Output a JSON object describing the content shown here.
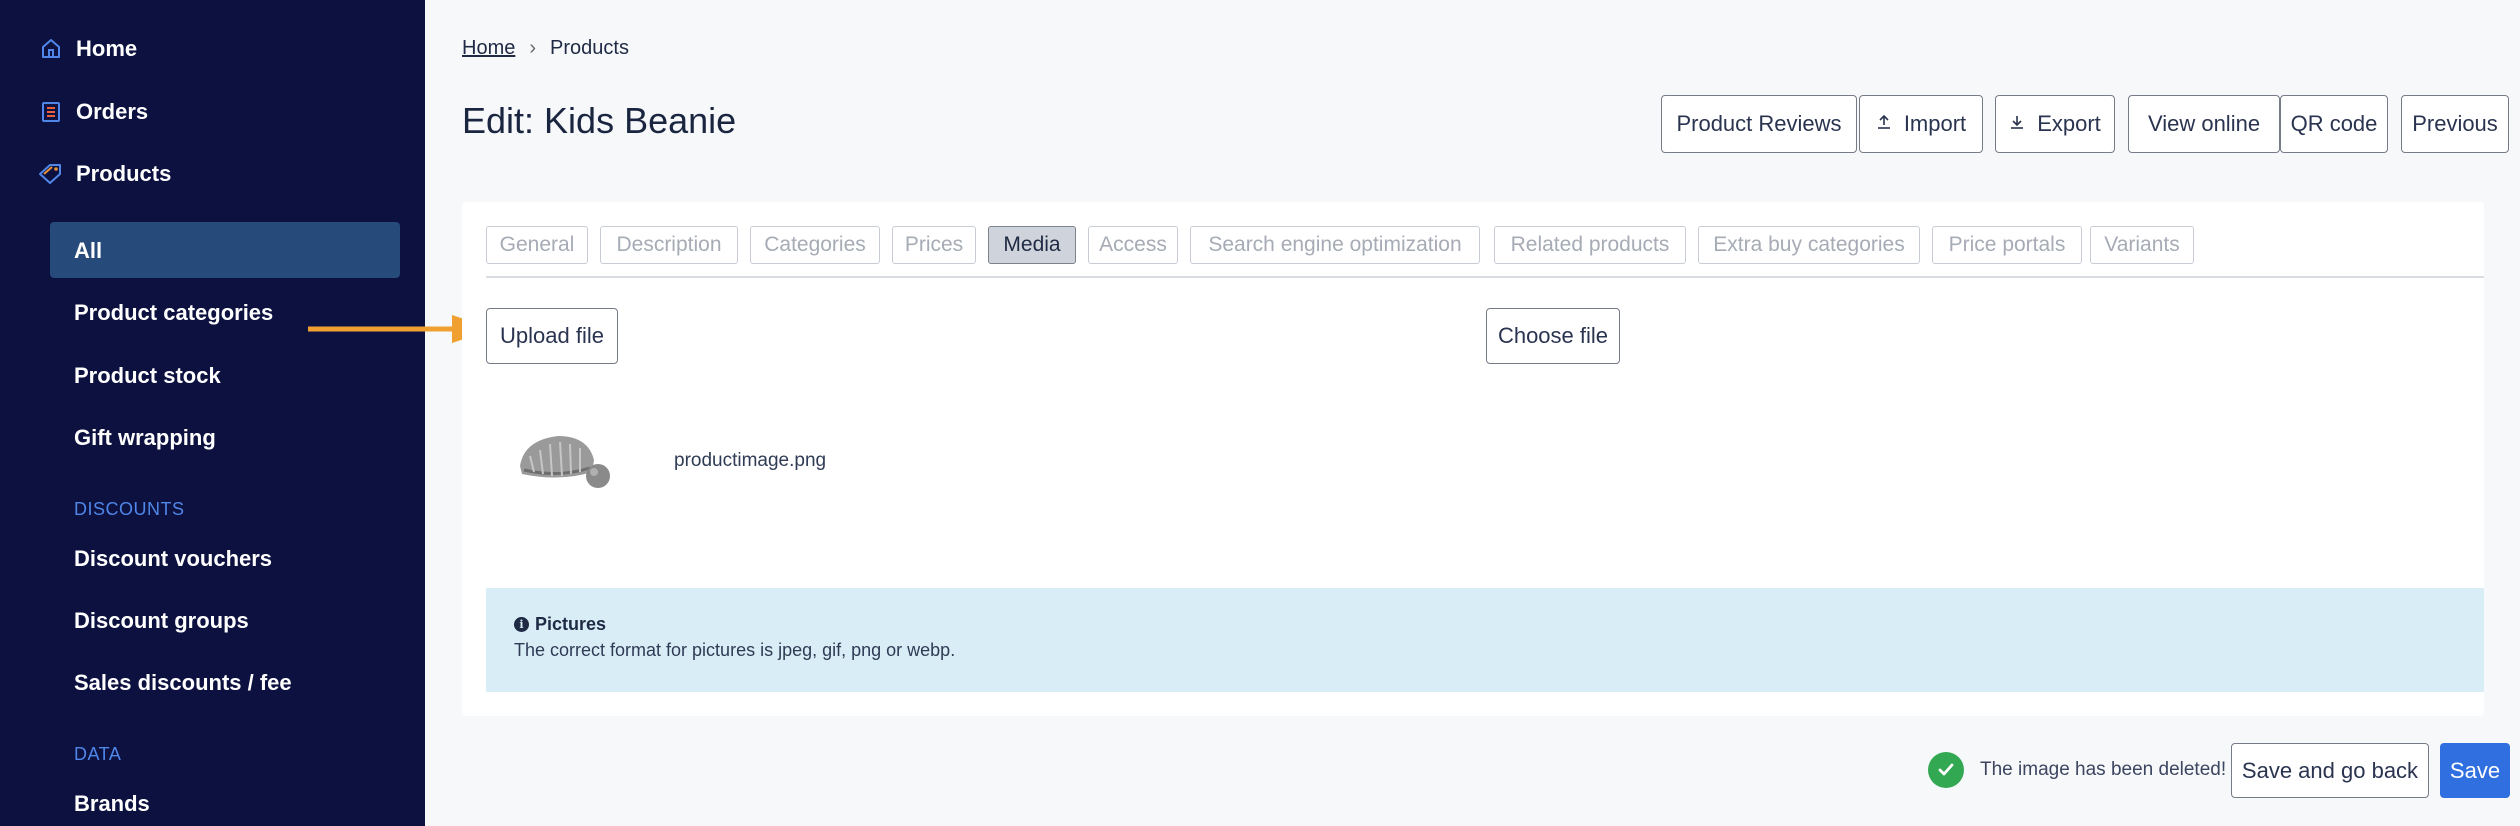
{
  "sidebar": {
    "home": "Home",
    "orders": "Orders",
    "products": "Products",
    "sub_items": [
      "All",
      "Product categories",
      "Product stock",
      "Gift wrapping"
    ],
    "discounts_heading": "DISCOUNTS",
    "discount_items": [
      "Discount vouchers",
      "Discount groups",
      "Sales discounts / fee"
    ],
    "data_heading": "DATA",
    "data_items": [
      "Brands"
    ],
    "active_item": "All"
  },
  "breadcrumb": {
    "home": "Home",
    "separator": ">",
    "current": "Products"
  },
  "page_title": "Edit: Kids Beanie",
  "toolbar": {
    "product_reviews": "Product Reviews",
    "import": "Import",
    "export": "Export",
    "view_online": "View online",
    "qr_code": "QR code",
    "previous": "Previous"
  },
  "tabs": [
    "General",
    "Description",
    "Categories",
    "Prices",
    "Media",
    "Access",
    "Search engine optimization",
    "Related products",
    "Extra buy categories",
    "Price portals",
    "Variants"
  ],
  "active_tab": "Media",
  "media": {
    "upload_label": "Upload file",
    "choose_label": "Choose file",
    "file_name": "productimage.png"
  },
  "info": {
    "title": "Pictures",
    "text": "The correct format for pictures is jpeg, gif, png or webp."
  },
  "footer": {
    "toast": "The image has been deleted!",
    "save_and_go_back": "Save and go back",
    "save": "Save"
  },
  "colors": {
    "sidebar_bg": "#0c1140",
    "sidebar_active": "#264a7a",
    "section_heading": "#4f86e8",
    "primary": "#2f6fe0",
    "success": "#33a852",
    "info_bg": "#d9edf6",
    "annotation_arrow": "#f0a030"
  }
}
